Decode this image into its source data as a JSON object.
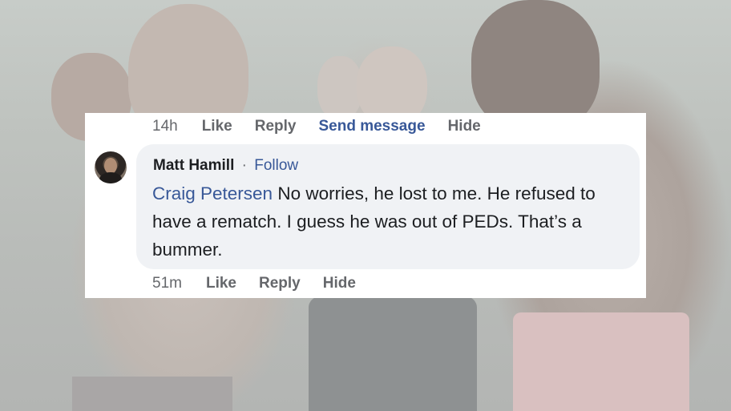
{
  "prev_comment_actions": {
    "time": "14h",
    "like": "Like",
    "reply": "Reply",
    "send_message": "Send message",
    "hide": "Hide"
  },
  "comment": {
    "author": "Matt Hamill",
    "separator": "·",
    "follow": "Follow",
    "mention": "Craig Petersen",
    "body": " No worries, he lost to me. He refused to have a rematch. I guess he was out of PEDs. That’s a bummer."
  },
  "comment_actions": {
    "time": "51m",
    "like": "Like",
    "reply": "Reply",
    "hide": "Hide"
  },
  "colors": {
    "link_blue": "#385898",
    "meta_gray": "#65676b",
    "bubble_bg": "#f0f2f5"
  }
}
